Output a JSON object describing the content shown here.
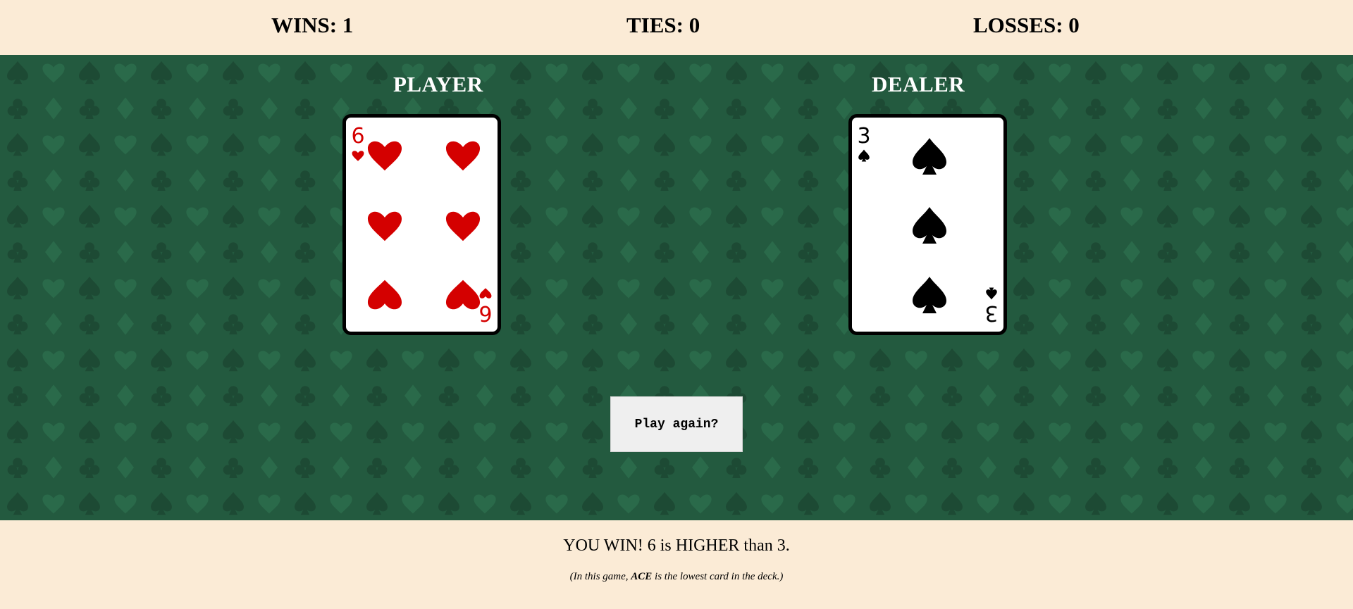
{
  "scoreboard": {
    "wins": "WINS: 1",
    "ties": "TIES: 0",
    "losses": "LOSSES: 0"
  },
  "table": {
    "player_label": "PLAYER",
    "dealer_label": "DEALER",
    "felt_color": "#235a3f",
    "player_card": {
      "rank": "6",
      "suit": "hearts",
      "suit_icon": "heart-icon",
      "color": "#d40000"
    },
    "dealer_card": {
      "rank": "3",
      "suit": "spades",
      "suit_icon": "spade-icon",
      "color": "#000000"
    },
    "play_again_label": "Play again?"
  },
  "footer": {
    "result_text": "YOU WIN! 6 is HIGHER than 3.",
    "note_prefix": "(In this game, ",
    "note_bold": "ACE",
    "note_suffix": " is the lowest card in the deck.)"
  },
  "colors": {
    "background": "#fbebd6",
    "felt": "#235a3f",
    "button": "#efefef"
  }
}
